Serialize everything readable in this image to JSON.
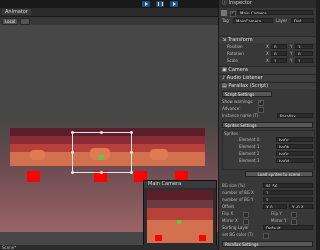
{
  "toolbar": {
    "play_icon": "play-icon",
    "pause_icon": "pause-icon",
    "step_icon": "step-icon"
  },
  "scene": {
    "tab_label": "Animator",
    "tool_mode": "Local",
    "footer_label": "Scene*",
    "colors": {
      "strip_dark": "#5a1f2a",
      "strip_mid": "#a33a3a",
      "strip_light": "#d06a4a",
      "red_square": "#ff0000",
      "gradient_bottom": "#9a6467"
    }
  },
  "camera_preview": {
    "title": "Main Camera"
  },
  "inspector": {
    "tab_label": "Inspector",
    "object_name": "Main Camera",
    "tag_label": "Tag",
    "tag_value": "MainCamera",
    "layer_label": "Layer",
    "layer_value": "Def",
    "transform": {
      "title": "Transform",
      "rows": [
        {
          "label": "Position",
          "x": "0",
          "y": "3"
        },
        {
          "label": "Rotation",
          "x": "0",
          "y": "0"
        },
        {
          "label": "Scale",
          "x": "1",
          "y": "1"
        }
      ],
      "axis_x": "X",
      "axis_y": "Y"
    },
    "components": {
      "camera": "Camera",
      "audio": "Audio Listener",
      "parallax": "Parallax (Script)"
    },
    "script_settings": {
      "title": "Script Settings",
      "show_warnings": "Show warnings:",
      "advance": "Advance:",
      "instance_name_label": "Instance name (T)",
      "instance_name_value": "Parallax"
    },
    "sprites_settings": {
      "title": "Sprites Settings"
    },
    "sprites": {
      "title": "Sprites",
      "elements": [
        {
          "label": "Element 0",
          "value": "bg0c"
        },
        {
          "label": "Element 1",
          "value": "bg0b"
        },
        {
          "label": "Element 2",
          "value": "bg0c"
        },
        {
          "label": "Element 3",
          "value": "bg0d"
        }
      ],
      "load_button": "Load sprites to scene"
    },
    "bg": {
      "rows": [
        {
          "label": "BG size (%)",
          "value": "91.56"
        },
        {
          "label": "number of BG X",
          "value": "1"
        },
        {
          "label": "number of BG Y",
          "value": "1"
        },
        {
          "label": "Offset",
          "value": "X 0"
        },
        {
          "label": "Flip X",
          "value": ""
        },
        {
          "label": "Mirror X",
          "value": ""
        },
        {
          "label": "Sorting Layer",
          "value": "Default"
        },
        {
          "label": "set BG color (T)",
          "value": ""
        }
      ],
      "offset_y": "Y -0.4",
      "flip_y": "Flip Y",
      "mirror_y": "Mirror Y"
    },
    "parallax_settings": {
      "title": "Parallax Settings"
    }
  }
}
